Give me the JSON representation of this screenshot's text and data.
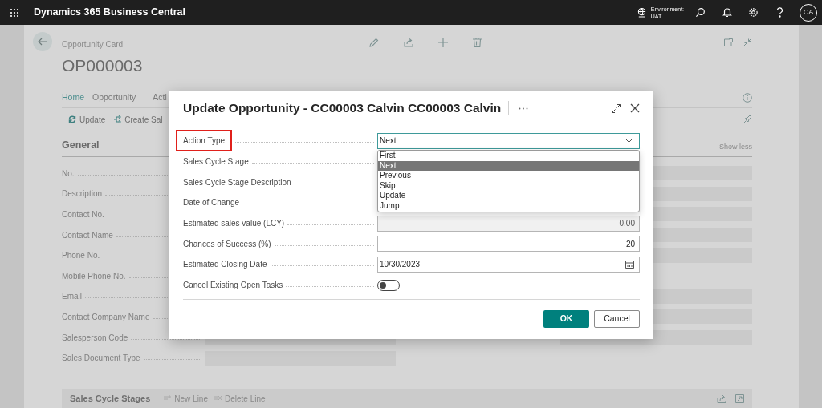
{
  "app_bar": {
    "title": "Dynamics 365 Business Central",
    "environment_label": "Environment:",
    "environment": "UAT",
    "avatar": "CA"
  },
  "page": {
    "caption": "Opportunity Card",
    "number": "OP000003",
    "tabs": [
      {
        "label": "Home",
        "selected": true
      },
      {
        "label": "Opportunity",
        "selected": false
      },
      {
        "label": "Acti",
        "selected": false
      }
    ],
    "actions": [
      "Update",
      "Create Sal"
    ],
    "section": {
      "title": "General",
      "toggle": "Show less"
    },
    "left_fields": [
      "No.",
      "Description",
      "Contact No.",
      "Contact Name",
      "Phone No.",
      "Mobile Phone No.",
      "Email",
      "Contact Company Name",
      "Salesperson Code",
      "Sales Document Type"
    ],
    "lines_section": {
      "title": "Sales Cycle Stages",
      "actions": [
        {
          "label": "New Line",
          "disabled": true
        },
        {
          "label": "Delete Line",
          "disabled": true
        }
      ]
    }
  },
  "dialog": {
    "title": "Update Opportunity - CC00003 Calvin CC00003 Calvin",
    "fields": [
      {
        "label": "Action Type",
        "kind": "select",
        "value": "Next",
        "highlighted": true,
        "options": [
          {
            "label": "First",
            "selected": false
          },
          {
            "label": "Next",
            "selected": true
          },
          {
            "label": "Previous",
            "selected": false
          },
          {
            "label": "Skip",
            "selected": false
          },
          {
            "label": "Update",
            "selected": false
          },
          {
            "label": "Jump",
            "selected": false
          }
        ]
      },
      {
        "label": "Sales Cycle Stage",
        "kind": "covered",
        "highlighted": false
      },
      {
        "label": "Sales Cycle Stage Description",
        "kind": "covered",
        "highlighted": false
      },
      {
        "label": "Date of Change",
        "kind": "covered",
        "highlighted": false
      },
      {
        "label": "Estimated sales value (LCY)",
        "kind": "number",
        "value": "0.00",
        "disabled": true,
        "highlighted": false
      },
      {
        "label": "Chances of Success (%)",
        "kind": "number",
        "value": "20",
        "disabled": false,
        "highlighted": false
      },
      {
        "label": "Estimated Closing Date",
        "kind": "date",
        "value": "10/30/2023",
        "highlighted": false
      },
      {
        "label": "Cancel Existing Open Tasks",
        "kind": "toggle",
        "on": false,
        "highlighted": false
      }
    ],
    "buttons": [
      {
        "label": "OK",
        "primary": true
      },
      {
        "label": "Cancel",
        "primary": false
      }
    ]
  }
}
